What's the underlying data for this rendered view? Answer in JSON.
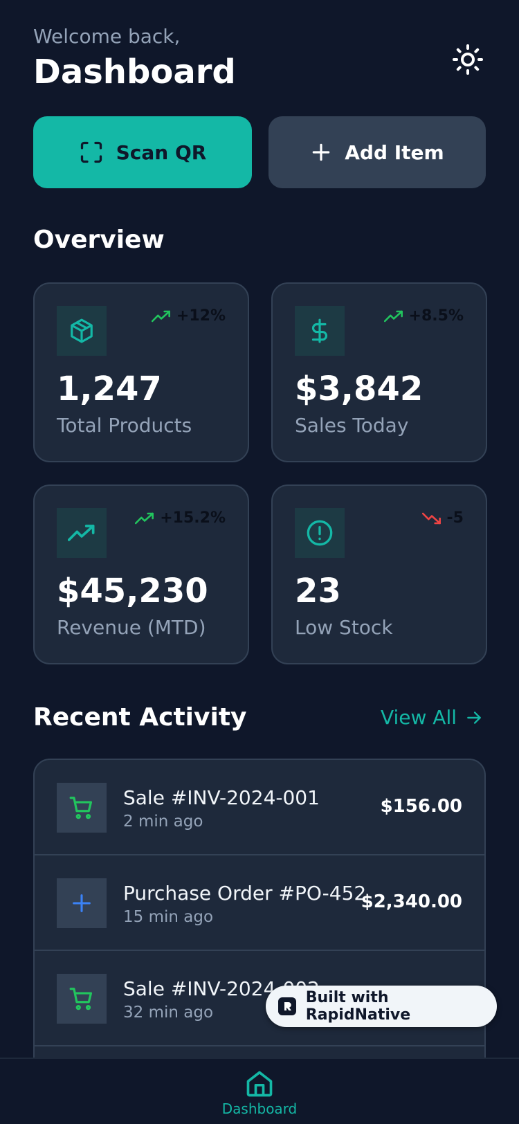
{
  "header": {
    "welcome": "Welcome back,",
    "title": "Dashboard",
    "theme_icon": "sun-icon"
  },
  "actions": {
    "scan_label": "Scan QR",
    "add_label": "Add Item"
  },
  "overview": {
    "title": "Overview",
    "cards": [
      {
        "icon": "package-icon",
        "trend_icon": "trending-up-icon",
        "trend": "+12%",
        "trend_color": "#22c55e",
        "value": "1,247",
        "label": "Total Products"
      },
      {
        "icon": "dollar-icon",
        "trend_icon": "trending-up-icon",
        "trend": "+8.5%",
        "trend_color": "#22c55e",
        "value": "$3,842",
        "label": "Sales Today"
      },
      {
        "icon": "trending-up-icon",
        "trend_icon": "trending-up-icon",
        "trend": "+15.2%",
        "trend_color": "#22c55e",
        "value": "$45,230",
        "label": "Revenue (MTD)"
      },
      {
        "icon": "alert-circle-icon",
        "trend_icon": "trending-down-icon",
        "trend": "-5",
        "trend_color": "#ef4444",
        "value": "23",
        "label": "Low Stock"
      }
    ]
  },
  "activity": {
    "title": "Recent Activity",
    "view_all": "View All",
    "items": [
      {
        "icon": "cart-icon",
        "title": "Sale #INV-2024-001",
        "time": "2 min ago",
        "amount": "$156.00"
      },
      {
        "icon": "plus-icon",
        "title": "Purchase Order #PO-452",
        "time": "15 min ago",
        "amount": "$2,340.00"
      },
      {
        "icon": "cart-icon",
        "title": "Sale #INV-2024-002",
        "time": "32 min ago",
        "amount": ""
      }
    ]
  },
  "badge": {
    "label": "Built with RapidNative"
  },
  "tabbar": {
    "home_label": "Dashboard"
  },
  "colors": {
    "accent": "#14b8a6",
    "background": "#0f172a",
    "card": "#1e293b",
    "up": "#22c55e",
    "down": "#ef4444"
  }
}
